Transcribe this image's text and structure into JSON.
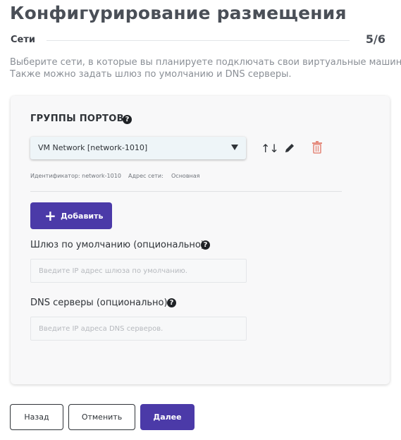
{
  "header": {
    "title": "Конфигурирование размещения",
    "step_name": "Сети",
    "step_counter": "5/6",
    "description_line1": "Выберите сети, в которые вы планируете подключать свои виртуальные машины.",
    "description_line2": "Также можно задать шлюз по умолчанию и DNS серверы."
  },
  "port_groups": {
    "title": "ГРУППЫ ПОРТОВ",
    "help_glyph": "?",
    "selected": "VM Network [network-1010]",
    "meta": {
      "id_label": "Идентификатор: network-1010",
      "address_label": "Адрес сети:",
      "address_value": "Основная"
    },
    "icons": {
      "sort": "sort-arrows-icon",
      "edit": "pencil-icon",
      "delete": "trash-icon"
    },
    "add_label": "Добавить",
    "add_glyph": "+"
  },
  "gateway": {
    "label": "Шлюз по умолчанию (опционально)",
    "value": "",
    "placeholder": "Введите IP адрес шлюза по умолчанию."
  },
  "dns": {
    "label": "DNS серверы (опционально)",
    "value": "",
    "placeholder": "Введите IP адреса DNS серверов."
  },
  "footer": {
    "back_label": "Назад",
    "cancel_label": "Отменить",
    "next_label": "Далее"
  },
  "colors": {
    "accent": "#4b3aa8",
    "delete": "#e58b7d",
    "text_dark": "#2f3338",
    "text_muted": "#8a8f96"
  }
}
